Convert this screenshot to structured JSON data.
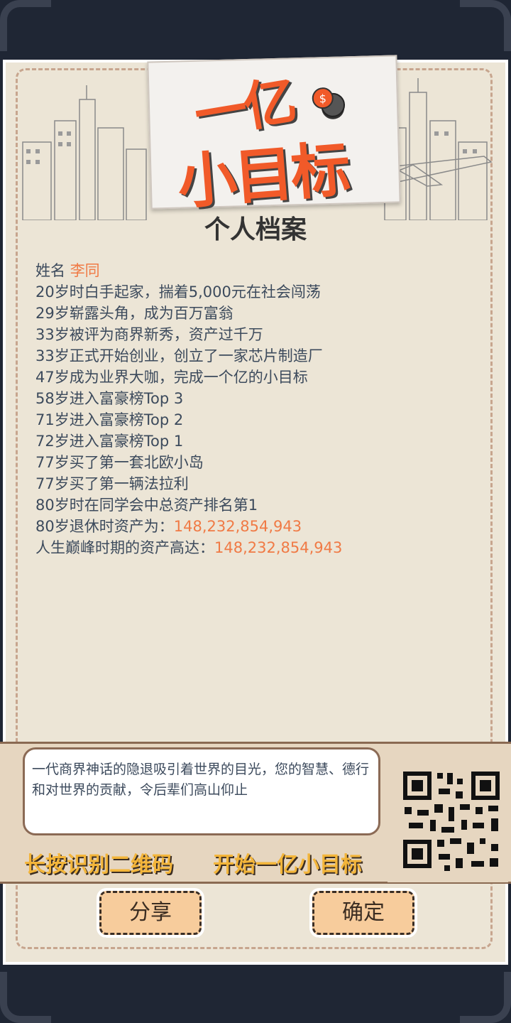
{
  "logo": {
    "line1": "一亿",
    "line2": "小目标"
  },
  "page_title": "个人档案",
  "profile": {
    "name_label": "姓名",
    "name_value": "李同",
    "events": [
      "20岁时白手起家，揣着5,000元在社会闯荡",
      "29岁崭露头角，成为百万富翁",
      "33岁被评为商界新秀，资产过千万",
      "33岁正式开始创业，创立了一家芯片制造厂",
      "47岁成为业界大咖，完成一个亿的小目标",
      "58岁进入富豪榜Top 3",
      "71岁进入富豪榜Top 2",
      "72岁进入富豪榜Top 1",
      "77岁买了第一套北欧小岛",
      "77岁买了第一辆法拉利",
      "80岁时在同学会中总资产排名第1"
    ],
    "retire_label": "80岁退休时资产为：",
    "retire_value": "148,232,854,943",
    "peak_label": "人生巅峰时期的资产高达：",
    "peak_value": "148,232,854,943"
  },
  "quote": "一代商界神话的隐退吸引着世界的目光，您的智慧、德行和对世界的贡献，令后辈们高山仰止",
  "qr": {
    "hint_left": "长按识别二维码",
    "hint_right": "开始一亿小目标"
  },
  "buttons": {
    "share": "分享",
    "confirm": "确定"
  },
  "colors": {
    "accent": "#f15a29",
    "highlight": "#f07a45",
    "hint_text": "#f3b53a",
    "button_bg": "#f7cc9c"
  }
}
